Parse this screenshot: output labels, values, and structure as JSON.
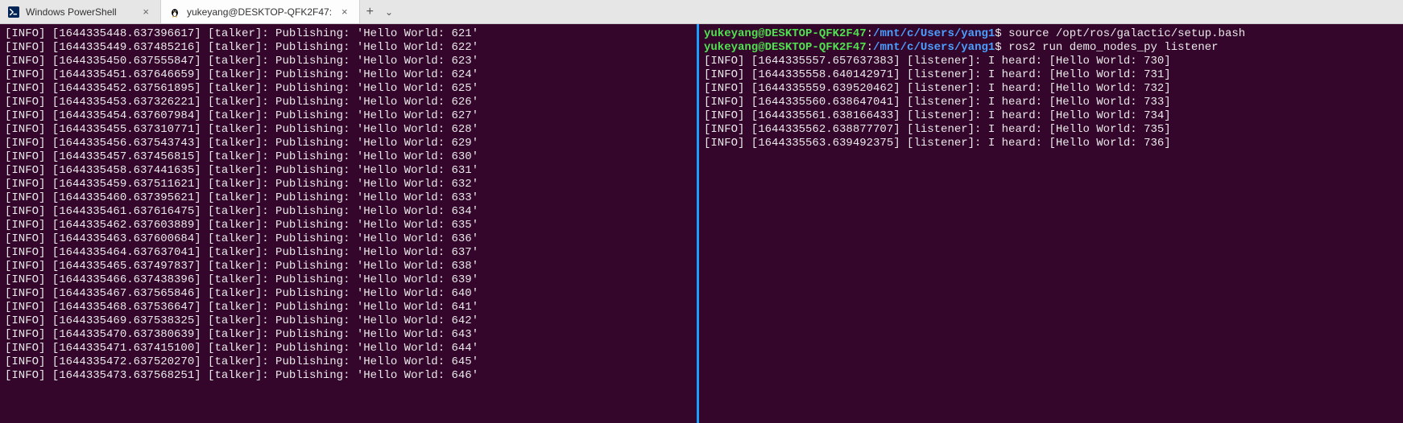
{
  "tabs": [
    {
      "label": "Windows PowerShell",
      "iconColor": "#012456",
      "active": false
    },
    {
      "label": "yukeyang@DESKTOP-QFK2F47:",
      "iconColor": "#000000",
      "active": true
    }
  ],
  "colors": {
    "terminalBg": "#34062b",
    "terminalFg": "#e9e9e9",
    "promptUser": "#4fe24f",
    "promptPath": "#4a9fff",
    "divider": "#1a9fff"
  },
  "leftPane": {
    "lines": [
      "[INFO] [1644335448.637396617] [talker]: Publishing: 'Hello World: 621'",
      "[INFO] [1644335449.637485216] [talker]: Publishing: 'Hello World: 622'",
      "[INFO] [1644335450.637555847] [talker]: Publishing: 'Hello World: 623'",
      "[INFO] [1644335451.637646659] [talker]: Publishing: 'Hello World: 624'",
      "[INFO] [1644335452.637561895] [talker]: Publishing: 'Hello World: 625'",
      "[INFO] [1644335453.637326221] [talker]: Publishing: 'Hello World: 626'",
      "[INFO] [1644335454.637607984] [talker]: Publishing: 'Hello World: 627'",
      "[INFO] [1644335455.637310771] [talker]: Publishing: 'Hello World: 628'",
      "[INFO] [1644335456.637543743] [talker]: Publishing: 'Hello World: 629'",
      "[INFO] [1644335457.637456815] [talker]: Publishing: 'Hello World: 630'",
      "[INFO] [1644335458.637441635] [talker]: Publishing: 'Hello World: 631'",
      "[INFO] [1644335459.637511621] [talker]: Publishing: 'Hello World: 632'",
      "[INFO] [1644335460.637395621] [talker]: Publishing: 'Hello World: 633'",
      "[INFO] [1644335461.637616475] [talker]: Publishing: 'Hello World: 634'",
      "[INFO] [1644335462.637603889] [talker]: Publishing: 'Hello World: 635'",
      "[INFO] [1644335463.637600684] [talker]: Publishing: 'Hello World: 636'",
      "[INFO] [1644335464.637637041] [talker]: Publishing: 'Hello World: 637'",
      "[INFO] [1644335465.637497837] [talker]: Publishing: 'Hello World: 638'",
      "[INFO] [1644335466.637438396] [talker]: Publishing: 'Hello World: 639'",
      "[INFO] [1644335467.637565846] [talker]: Publishing: 'Hello World: 640'",
      "[INFO] [1644335468.637536647] [talker]: Publishing: 'Hello World: 641'",
      "[INFO] [1644335469.637538325] [talker]: Publishing: 'Hello World: 642'",
      "[INFO] [1644335470.637380639] [talker]: Publishing: 'Hello World: 643'",
      "[INFO] [1644335471.637415100] [talker]: Publishing: 'Hello World: 644'",
      "[INFO] [1644335472.637520270] [talker]: Publishing: 'Hello World: 645'",
      "[INFO] [1644335473.637568251] [talker]: Publishing: 'Hello World: 646'"
    ]
  },
  "rightPane": {
    "prompt": {
      "userHost": "yukeyang@DESKTOP-QFK2F47",
      "path": "/mnt/c/Users/yang1",
      "symbol": "$"
    },
    "commands": [
      "source /opt/ros/galactic/setup.bash",
      "ros2 run demo_nodes_py listener"
    ],
    "lines": [
      "[INFO] [1644335557.657637383] [listener]: I heard: [Hello World: 730]",
      "[INFO] [1644335558.640142971] [listener]: I heard: [Hello World: 731]",
      "[INFO] [1644335559.639520462] [listener]: I heard: [Hello World: 732]",
      "[INFO] [1644335560.638647041] [listener]: I heard: [Hello World: 733]",
      "[INFO] [1644335561.638166433] [listener]: I heard: [Hello World: 734]",
      "[INFO] [1644335562.638877707] [listener]: I heard: [Hello World: 735]",
      "[INFO] [1644335563.639492375] [listener]: I heard: [Hello World: 736]"
    ]
  }
}
